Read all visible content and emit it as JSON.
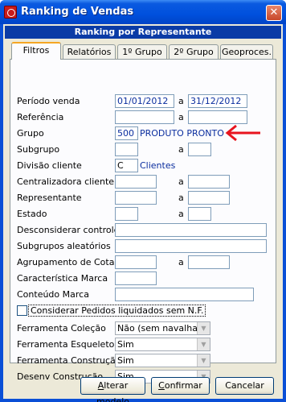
{
  "window": {
    "title": "Ranking de Vendas",
    "close_glyph": "✕"
  },
  "header": {
    "title": "Ranking por Representante"
  },
  "tabs": [
    {
      "label": "Filtros",
      "active": true
    },
    {
      "label": "Relatórios",
      "active": false
    },
    {
      "label": "1º Grupo",
      "active": false
    },
    {
      "label": "2º Grupo",
      "active": false
    },
    {
      "label": "Geoproces.",
      "active": false
    }
  ],
  "form": {
    "periodo": {
      "label": "Período venda",
      "from": "01/01/2012",
      "sep": "a",
      "to": "31/12/2012"
    },
    "referencia": {
      "label": "Referência",
      "from": "",
      "sep": "a",
      "to": ""
    },
    "grupo": {
      "label": "Grupo",
      "code": "500",
      "description": "PRODUTO PRONTO"
    },
    "subgrupo": {
      "label": "Subgrupo",
      "from": "",
      "sep": "a",
      "to": ""
    },
    "divisao": {
      "label": "Divisão cliente",
      "code": "C",
      "description": "Clientes"
    },
    "centralizadora": {
      "label": "Centralizadora cliente",
      "from": "",
      "sep": "a",
      "to": ""
    },
    "representante": {
      "label": "Representante",
      "from": "",
      "sep": "a",
      "to": ""
    },
    "estado": {
      "label": "Estado",
      "from": "",
      "sep": "a",
      "to": ""
    },
    "desconsiderar": {
      "label": "Desconsiderar controles",
      "value": ""
    },
    "subgrupos_aleatorios": {
      "label": "Subgrupos aleatórios",
      "value": ""
    },
    "agrupamento": {
      "label": "Agrupamento de Cotas",
      "from": "",
      "sep": "a",
      "to": ""
    },
    "caracteristica": {
      "label": "Característica Marca",
      "value": ""
    },
    "conteudo": {
      "label": "Conteúdo Marca",
      "value": ""
    },
    "considerar": {
      "label": "Considerar Pedidos liquidados sem N.F.",
      "checked": false
    },
    "ferramenta_colecao": {
      "label": "Ferramenta Coleção",
      "value": "Não (sem navalha)"
    },
    "ferramenta_esqueleto": {
      "label": "Ferramenta Esqueleto",
      "value": "Sim"
    },
    "ferramenta_construcao": {
      "label": "Ferramenta Construção",
      "value": "Sim"
    },
    "desenv_construcao": {
      "label": "Desenv Construção",
      "value": "Sim"
    }
  },
  "buttons": {
    "alterar": {
      "mnemonic": "A",
      "rest": "lterar modelo"
    },
    "confirmar": {
      "mnemonic": "C",
      "rest": "onfirmar"
    },
    "cancelar": {
      "label": "Cancelar"
    }
  },
  "colors": {
    "annotation_arrow": "#e8141e",
    "title_bar": "#0a5ae0",
    "header_bar": "#0a3ba6"
  }
}
